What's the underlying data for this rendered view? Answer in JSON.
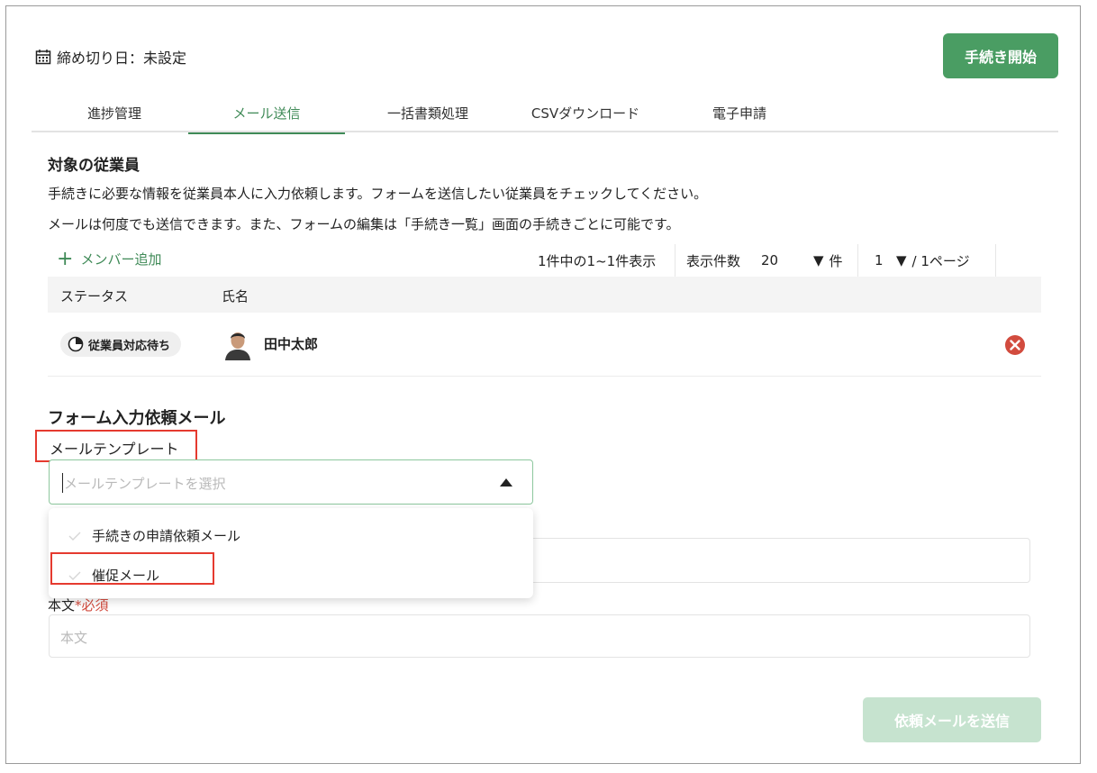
{
  "header": {
    "deadline_text": "締め切り日：未設定",
    "start_button": "手続き開始"
  },
  "tabs": [
    {
      "label": "進捗管理",
      "active": false
    },
    {
      "label": "メール送信",
      "active": true
    },
    {
      "label": "一括書類処理",
      "active": false
    },
    {
      "label": "CSVダウンロード",
      "active": false
    },
    {
      "label": "電子申請",
      "active": false
    }
  ],
  "employees": {
    "title": "対象の従業員",
    "desc1": "手続きに必要な情報を従業員本人に入力依頼します。フォームを送信したい従業員をチェックしてください。",
    "desc2": "メールは何度でも送信できます。また、フォームの編集は「手続き一覧」画面の手続きごとに可能です。",
    "add_member": "メンバー追加",
    "pager": {
      "summary": "1件中の1~1件表示",
      "per_page_label": "表示件数",
      "per_page_value": "20",
      "per_page_unit": "件",
      "page_value": "1",
      "page_total": "/ 1ページ"
    },
    "columns": {
      "status": "ステータス",
      "name": "氏名"
    },
    "rows": [
      {
        "status": "従業員対応待ち",
        "name": "田中太郎"
      }
    ]
  },
  "form": {
    "title": "フォーム入力依頼メール",
    "template_label": "メールテンプレート",
    "template_placeholder": "メールテンプレートを選択",
    "template_options": [
      "手続きの申請依頼メール",
      "催促メール"
    ],
    "body_label": "本文",
    "body_required": "*必須",
    "body_placeholder": "本文",
    "send_button": "依頼メールを送信"
  },
  "colors": {
    "accent": "#4a9d63",
    "highlight_box": "#e53a2f",
    "disabled_button": "#c6e3cf",
    "remove_icon": "#d24b3e"
  }
}
